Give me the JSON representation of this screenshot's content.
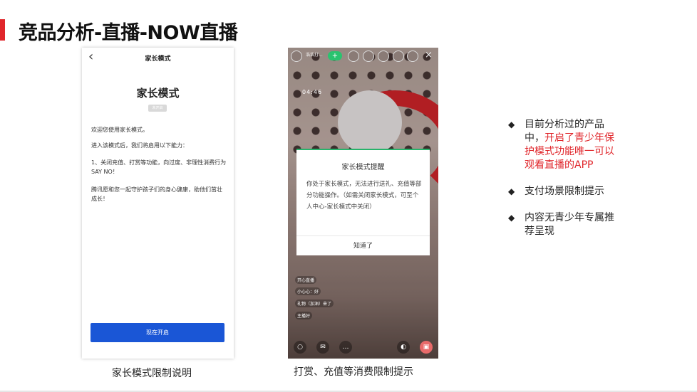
{
  "title": "竞品分析-直播-NOW直播",
  "phone1": {
    "back_icon": "‹",
    "topbar_title": "家长模式",
    "heading": "家长模式",
    "badge": "未开启",
    "paragraphs": [
      "欢迎您使用家长模式。",
      "进入该模式后，我们将启用以下能力：",
      "1、关闭充值、打赏等功能，向过度、非理性消费行为SAY NO！",
      "腾讯愿和您一起守护孩子们的身心健康，助他们茁壮成长！"
    ],
    "button": "现在开启",
    "caption": "家长模式限制说明"
  },
  "phone2": {
    "streamer_name": "浩浩打...",
    "plus": "+",
    "close": "×",
    "timer": "04:46",
    "modal": {
      "title": "家长模式提醒",
      "body": "你处于家长模式，无法进行送礼、充值等部分功能操作。（如需关闭家长模式，可至个人中心-家长模式中关闭）",
      "button": "知道了"
    },
    "chats": [
      "开心直播",
      "小心心：好",
      "礼物（加油）来了",
      "主播好"
    ],
    "caption": "打赏、充值等消费限制提示"
  },
  "bullets": {
    "b1_plain": "目前分析过的产品中，",
    "b1_red": "开启了青少年保护模式功能唯一可以观看直播的APP",
    "b2": "支付场景限制提示",
    "b3": "内容无青少年专属推荐呈现"
  }
}
